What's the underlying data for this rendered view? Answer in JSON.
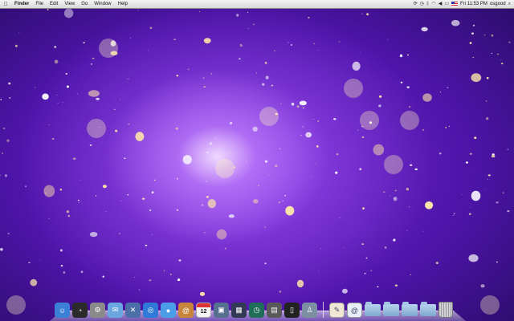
{
  "menubar": {
    "apple_icon": "apple-logo-icon",
    "app_name": "Finder",
    "menus": [
      "File",
      "Edit",
      "View",
      "Go",
      "Window",
      "Help"
    ],
    "status_icons": [
      "sync-icon",
      "timemachine-icon",
      "bluetooth-icon",
      "wifi-icon",
      "volume-icon",
      "battery-icon",
      "input-flag-icon"
    ],
    "clock": "Fri 11:53 PM",
    "user": "osgood",
    "spotlight_icon": "spotlight-icon"
  },
  "dock": {
    "apps": [
      {
        "name": "finder-icon",
        "color": "#3b7fd6",
        "glyph": "☺"
      },
      {
        "name": "dashboard-icon",
        "color": "#2b2b2b",
        "glyph": "◔"
      },
      {
        "name": "system-preferences-icon",
        "color": "#8a8a8a",
        "glyph": "⚙"
      },
      {
        "name": "mail-icon",
        "color": "#6aa6e0",
        "glyph": "✉"
      },
      {
        "name": "xcode-icon",
        "color": "#4d6fa8",
        "glyph": "✕"
      },
      {
        "name": "safari-icon",
        "color": "#2f7ad8",
        "glyph": "◎"
      },
      {
        "name": "ichat-icon",
        "color": "#4a9de6",
        "glyph": "●"
      },
      {
        "name": "address-book-icon",
        "color": "#c9843b",
        "glyph": "@"
      },
      {
        "name": "ical-icon",
        "color": "#f2f2f2",
        "glyph": ""
      },
      {
        "name": "iphoto-icon",
        "color": "#56708f",
        "glyph": "▣"
      },
      {
        "name": "spaces-icon",
        "color": "#333a55",
        "glyph": "▦"
      },
      {
        "name": "time-machine-icon",
        "color": "#1f6e59",
        "glyph": "◷"
      },
      {
        "name": "expose-icon",
        "color": "#5a5a5a",
        "glyph": "▤"
      },
      {
        "name": "terminal-icon",
        "color": "#222222",
        "glyph": "▯"
      },
      {
        "name": "automator-icon",
        "color": "#7d8fa3",
        "glyph": "♙"
      }
    ],
    "ical_date": "12",
    "stacks": [
      {
        "name": "document-icon",
        "color": "#efe6d6",
        "glyph": "✎"
      },
      {
        "name": "mail-document-icon",
        "color": "#e8eef8",
        "glyph": "@"
      }
    ],
    "folders": [
      "folder-icon-1",
      "folder-icon-2",
      "folder-icon-3",
      "folder-icon-4"
    ],
    "trash_icon": "trash-icon"
  }
}
